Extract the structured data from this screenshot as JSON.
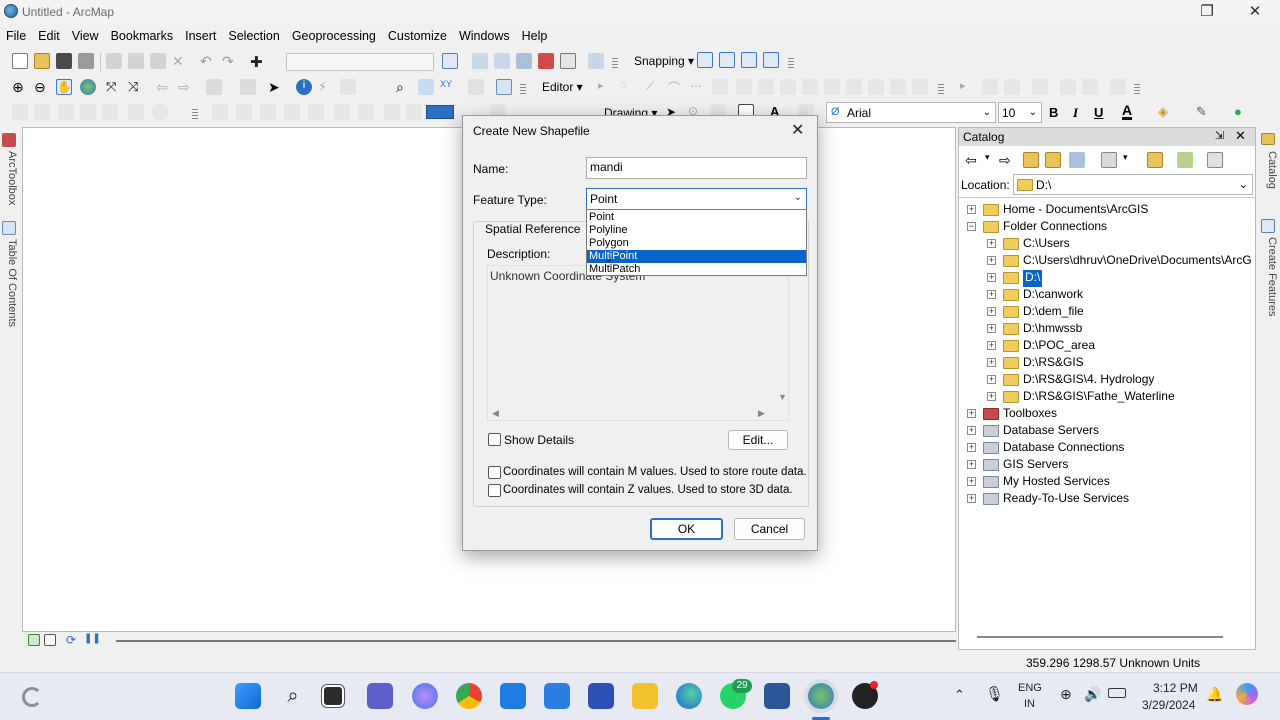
{
  "window": {
    "title": "Untitled - ArcMap"
  },
  "menu": [
    "File",
    "Edit",
    "View",
    "Bookmarks",
    "Insert",
    "Selection",
    "Geoprocessing",
    "Customize",
    "Windows",
    "Help"
  ],
  "toolbar": {
    "snapping_label": "Snapping ▾",
    "editor_label": "Editor ▾",
    "drawing_label": "Drawing ▾",
    "font_name": "Arial",
    "font_size": "10",
    "bold": "B",
    "italic": "I",
    "underline": "U",
    "font_color_glyph": "A"
  },
  "side_tabs": {
    "left": [
      "ArcToolbox",
      "Table Of Contents"
    ],
    "right": [
      "Catalog",
      "Create Features"
    ]
  },
  "catalog": {
    "title": "Catalog",
    "location_label": "Location:",
    "location_value": "D:\\",
    "tree": [
      {
        "label": "Home - Documents\\ArcGIS",
        "level": 0,
        "expander": "+"
      },
      {
        "label": "Folder Connections",
        "level": 0,
        "expander": "−"
      },
      {
        "label": "C:\\Users",
        "level": 1,
        "expander": "+"
      },
      {
        "label": "C:\\Users\\dhruv\\OneDrive\\Documents\\ArcG",
        "level": 1,
        "expander": "+"
      },
      {
        "label": "D:\\",
        "level": 1,
        "expander": "+",
        "selected": true
      },
      {
        "label": "D:\\canwork",
        "level": 1,
        "expander": "+"
      },
      {
        "label": "D:\\dem_file",
        "level": 1,
        "expander": "+"
      },
      {
        "label": "D:\\hmwssb",
        "level": 1,
        "expander": "+"
      },
      {
        "label": "D:\\POC_area",
        "level": 1,
        "expander": "+"
      },
      {
        "label": "D:\\RS&GIS",
        "level": 1,
        "expander": "+"
      },
      {
        "label": "D:\\RS&GIS\\4. Hydrology",
        "level": 1,
        "expander": "+"
      },
      {
        "label": "D:\\RS&GIS\\Fathe_Waterline",
        "level": 1,
        "expander": "+"
      },
      {
        "label": "Toolboxes",
        "level": 0,
        "expander": "+"
      },
      {
        "label": "Database Servers",
        "level": 0,
        "expander": "+"
      },
      {
        "label": "Database Connections",
        "level": 0,
        "expander": "+"
      },
      {
        "label": "GIS Servers",
        "level": 0,
        "expander": "+"
      },
      {
        "label": "My Hosted Services",
        "level": 0,
        "expander": "+"
      },
      {
        "label": "Ready-To-Use Services",
        "level": 0,
        "expander": "+"
      }
    ]
  },
  "dialog": {
    "title": "Create New Shapefile",
    "close_glyph": "✕",
    "name_label": "Name:",
    "name_value": "mandi",
    "feature_type_label": "Feature Type:",
    "feature_type_value": "Point",
    "feature_type_options": [
      "Point",
      "Polyline",
      "Polygon",
      "MultiPoint",
      "MultiPatch"
    ],
    "highlighted_option": "MultiPoint",
    "spatial_reference_label": "Spatial Reference",
    "description_label": "Description:",
    "description_value": "Unknown Coordinate System",
    "show_details_label": "Show Details",
    "edit_button": "Edit...",
    "m_values_label": "Coordinates will contain M values. Used to store route data.",
    "z_values_label": "Coordinates will contain Z values. Used to store 3D data.",
    "ok_button": "OK",
    "cancel_button": "Cancel"
  },
  "status": {
    "coordinates": "359.296  1298.57 Unknown Units"
  },
  "taskbar": {
    "language": "ENG",
    "region": "IN",
    "time": "3:12 PM",
    "date": "3/29/2024",
    "whatsapp_badge": "29"
  },
  "colors": {
    "accent": "#0a64c8",
    "selection": "#0a64c8",
    "folder": "#f0cc5c"
  }
}
